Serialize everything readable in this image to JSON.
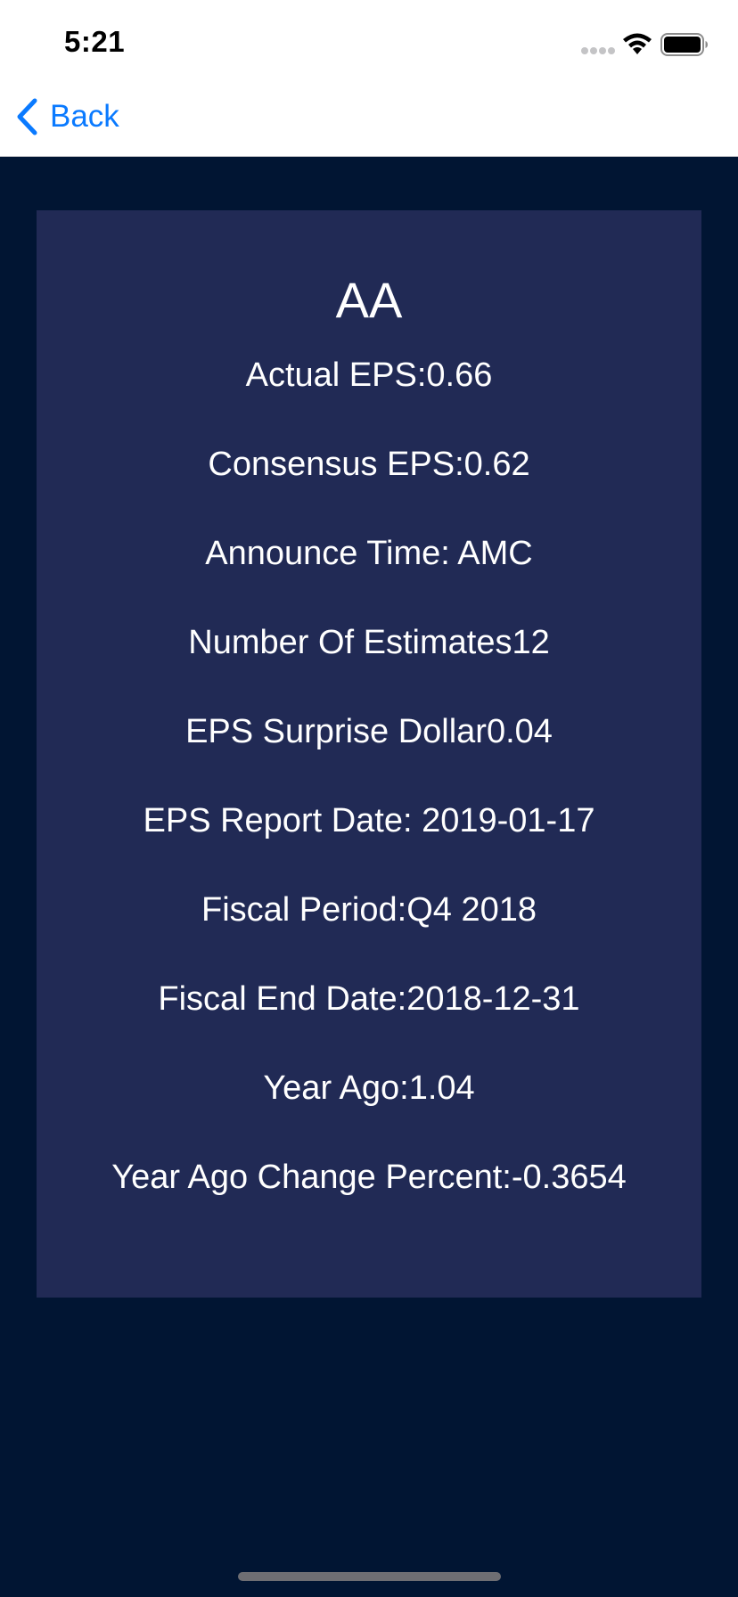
{
  "status_bar": {
    "time": "5:21"
  },
  "nav": {
    "back_label": "Back"
  },
  "card": {
    "title": "AA",
    "rows": [
      "Actual EPS:0.66",
      "Consensus EPS:0.62",
      "Announce Time: AMC",
      "Number Of Estimates12",
      "EPS Surprise Dollar0.04",
      "EPS Report Date: 2019-01-17",
      "Fiscal Period:Q4 2018",
      "Fiscal End Date:2018-12-31",
      "Year Ago:1.04",
      "Year Ago Change Percent:-0.3654"
    ]
  },
  "colors": {
    "background": "#011533",
    "card": "#212a55",
    "accent": "#0a7aff",
    "text": "#ffffff"
  },
  "icons": [
    "signal-dots-icon",
    "wifi-icon",
    "battery-icon",
    "chevron-left-icon"
  ]
}
